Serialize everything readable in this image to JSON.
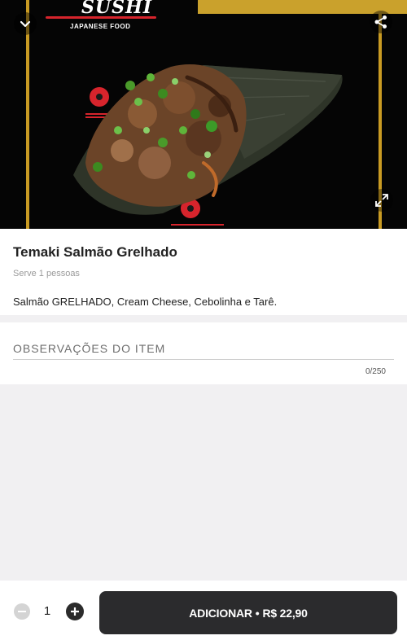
{
  "hero": {
    "logo_text": "SUSHI",
    "logo_subtext": "JAPANESE FOOD",
    "colors": {
      "frame_gold": "#c99b23",
      "logo_red": "#d7242c"
    }
  },
  "icons": {
    "collapse": "chevron-down-icon",
    "share": "share-icon",
    "expand": "expand-icon"
  },
  "item": {
    "title": "Temaki Salmão Grelhado",
    "serves": "Serve 1 pessoas",
    "description": "Salmão GRELHADO, Cream Cheese, Cebolinha e Tarê."
  },
  "observations": {
    "placeholder": "OBSERVAÇÕES DO ITEM",
    "value": "",
    "counter": "0/250"
  },
  "footer": {
    "quantity": "1",
    "add_label": "ADICIONAR",
    "separator": "•",
    "price": "R$ 22,90",
    "colors": {
      "button": "#2b2b2d"
    }
  }
}
